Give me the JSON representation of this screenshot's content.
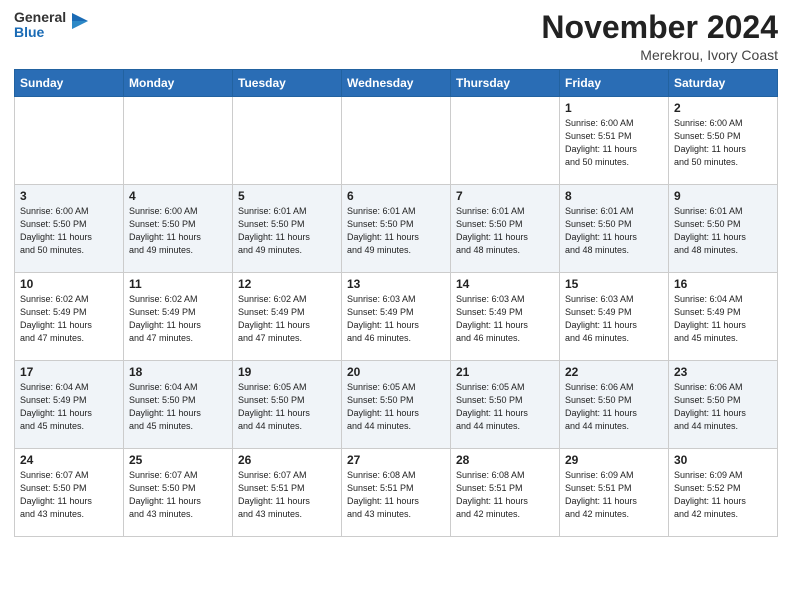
{
  "header": {
    "logo_general": "General",
    "logo_blue": "Blue",
    "month_title": "November 2024",
    "location": "Merekrou, Ivory Coast"
  },
  "weekdays": [
    "Sunday",
    "Monday",
    "Tuesday",
    "Wednesday",
    "Thursday",
    "Friday",
    "Saturday"
  ],
  "weeks": [
    [
      {
        "day": "",
        "info": ""
      },
      {
        "day": "",
        "info": ""
      },
      {
        "day": "",
        "info": ""
      },
      {
        "day": "",
        "info": ""
      },
      {
        "day": "",
        "info": ""
      },
      {
        "day": "1",
        "info": "Sunrise: 6:00 AM\nSunset: 5:51 PM\nDaylight: 11 hours\nand 50 minutes."
      },
      {
        "day": "2",
        "info": "Sunrise: 6:00 AM\nSunset: 5:50 PM\nDaylight: 11 hours\nand 50 minutes."
      }
    ],
    [
      {
        "day": "3",
        "info": "Sunrise: 6:00 AM\nSunset: 5:50 PM\nDaylight: 11 hours\nand 50 minutes."
      },
      {
        "day": "4",
        "info": "Sunrise: 6:00 AM\nSunset: 5:50 PM\nDaylight: 11 hours\nand 49 minutes."
      },
      {
        "day": "5",
        "info": "Sunrise: 6:01 AM\nSunset: 5:50 PM\nDaylight: 11 hours\nand 49 minutes."
      },
      {
        "day": "6",
        "info": "Sunrise: 6:01 AM\nSunset: 5:50 PM\nDaylight: 11 hours\nand 49 minutes."
      },
      {
        "day": "7",
        "info": "Sunrise: 6:01 AM\nSunset: 5:50 PM\nDaylight: 11 hours\nand 48 minutes."
      },
      {
        "day": "8",
        "info": "Sunrise: 6:01 AM\nSunset: 5:50 PM\nDaylight: 11 hours\nand 48 minutes."
      },
      {
        "day": "9",
        "info": "Sunrise: 6:01 AM\nSunset: 5:50 PM\nDaylight: 11 hours\nand 48 minutes."
      }
    ],
    [
      {
        "day": "10",
        "info": "Sunrise: 6:02 AM\nSunset: 5:49 PM\nDaylight: 11 hours\nand 47 minutes."
      },
      {
        "day": "11",
        "info": "Sunrise: 6:02 AM\nSunset: 5:49 PM\nDaylight: 11 hours\nand 47 minutes."
      },
      {
        "day": "12",
        "info": "Sunrise: 6:02 AM\nSunset: 5:49 PM\nDaylight: 11 hours\nand 47 minutes."
      },
      {
        "day": "13",
        "info": "Sunrise: 6:03 AM\nSunset: 5:49 PM\nDaylight: 11 hours\nand 46 minutes."
      },
      {
        "day": "14",
        "info": "Sunrise: 6:03 AM\nSunset: 5:49 PM\nDaylight: 11 hours\nand 46 minutes."
      },
      {
        "day": "15",
        "info": "Sunrise: 6:03 AM\nSunset: 5:49 PM\nDaylight: 11 hours\nand 46 minutes."
      },
      {
        "day": "16",
        "info": "Sunrise: 6:04 AM\nSunset: 5:49 PM\nDaylight: 11 hours\nand 45 minutes."
      }
    ],
    [
      {
        "day": "17",
        "info": "Sunrise: 6:04 AM\nSunset: 5:49 PM\nDaylight: 11 hours\nand 45 minutes."
      },
      {
        "day": "18",
        "info": "Sunrise: 6:04 AM\nSunset: 5:50 PM\nDaylight: 11 hours\nand 45 minutes."
      },
      {
        "day": "19",
        "info": "Sunrise: 6:05 AM\nSunset: 5:50 PM\nDaylight: 11 hours\nand 44 minutes."
      },
      {
        "day": "20",
        "info": "Sunrise: 6:05 AM\nSunset: 5:50 PM\nDaylight: 11 hours\nand 44 minutes."
      },
      {
        "day": "21",
        "info": "Sunrise: 6:05 AM\nSunset: 5:50 PM\nDaylight: 11 hours\nand 44 minutes."
      },
      {
        "day": "22",
        "info": "Sunrise: 6:06 AM\nSunset: 5:50 PM\nDaylight: 11 hours\nand 44 minutes."
      },
      {
        "day": "23",
        "info": "Sunrise: 6:06 AM\nSunset: 5:50 PM\nDaylight: 11 hours\nand 44 minutes."
      }
    ],
    [
      {
        "day": "24",
        "info": "Sunrise: 6:07 AM\nSunset: 5:50 PM\nDaylight: 11 hours\nand 43 minutes."
      },
      {
        "day": "25",
        "info": "Sunrise: 6:07 AM\nSunset: 5:50 PM\nDaylight: 11 hours\nand 43 minutes."
      },
      {
        "day": "26",
        "info": "Sunrise: 6:07 AM\nSunset: 5:51 PM\nDaylight: 11 hours\nand 43 minutes."
      },
      {
        "day": "27",
        "info": "Sunrise: 6:08 AM\nSunset: 5:51 PM\nDaylight: 11 hours\nand 43 minutes."
      },
      {
        "day": "28",
        "info": "Sunrise: 6:08 AM\nSunset: 5:51 PM\nDaylight: 11 hours\nand 42 minutes."
      },
      {
        "day": "29",
        "info": "Sunrise: 6:09 AM\nSunset: 5:51 PM\nDaylight: 11 hours\nand 42 minutes."
      },
      {
        "day": "30",
        "info": "Sunrise: 6:09 AM\nSunset: 5:52 PM\nDaylight: 11 hours\nand 42 minutes."
      }
    ]
  ]
}
